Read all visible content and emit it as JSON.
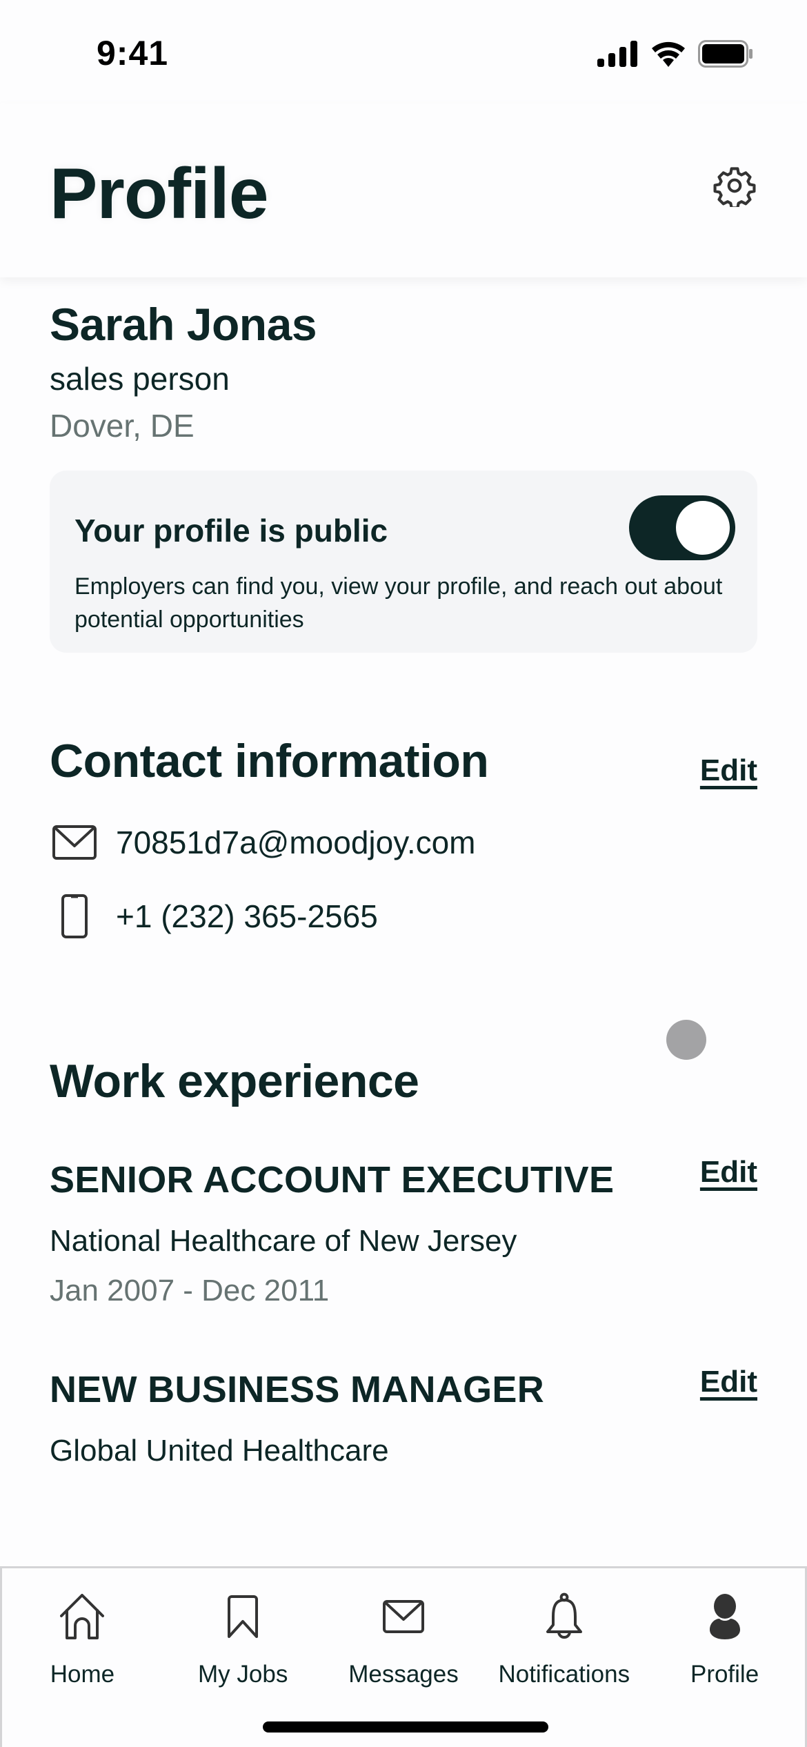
{
  "status_bar": {
    "time": "9:41",
    "icons": [
      "cellular-signal-icon",
      "wifi-icon",
      "battery-icon"
    ]
  },
  "header": {
    "title": "Profile",
    "settings_icon": "gear-icon"
  },
  "user": {
    "name": "Sarah Jonas",
    "title": "sales person",
    "location": "Dover, DE"
  },
  "visibility_card": {
    "title": "Your profile is public",
    "description": "Employers can find you, view your profile, and reach out about potential opportunities",
    "toggle_on": true
  },
  "contact": {
    "title": "Contact information",
    "edit_label": "Edit",
    "email": "70851d7a@moodjoy.com",
    "phone": "+1 (232) 365-2565",
    "email_icon": "envelope-icon",
    "phone_icon": "phone-icon"
  },
  "work": {
    "title": "Work experience",
    "jobs": [
      {
        "title": "SENIOR ACCOUNT EXECUTIVE",
        "company": "National Healthcare of New Jersey",
        "dates": "Jan 2007 - Dec 2011",
        "edit_label": "Edit"
      },
      {
        "title": "NEW BUSINESS MANAGER",
        "company": "Global United Healthcare",
        "edit_label": "Edit"
      }
    ]
  },
  "tabbar": {
    "items": [
      {
        "label": "Home",
        "icon": "home-icon"
      },
      {
        "label": "My Jobs",
        "icon": "bookmark-icon"
      },
      {
        "label": "Messages",
        "icon": "envelope-icon"
      },
      {
        "label": "Notifications",
        "icon": "bell-icon"
      },
      {
        "label": "Profile",
        "icon": "person-icon",
        "active": true
      }
    ]
  },
  "colors": {
    "primary_text": "#0d2626",
    "secondary_text": "#667372",
    "card_background": "#f4f5f7",
    "toggle_on": "#0d2626"
  }
}
